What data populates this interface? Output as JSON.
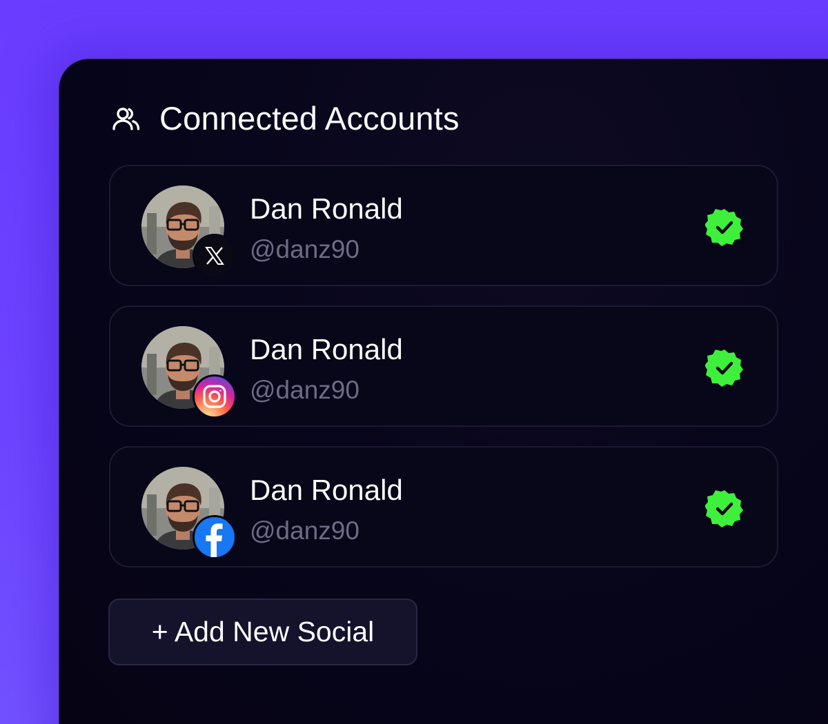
{
  "header": {
    "icon": "users-icon",
    "title": "Connected Accounts"
  },
  "accounts": [
    {
      "name": "Dan Ronald",
      "handle": "@danz90",
      "platform_icon": "x-logo-icon",
      "status_icon": "verified-check-icon"
    },
    {
      "name": "Dan Ronald",
      "handle": "@danz90",
      "platform_icon": "instagram-logo-icon",
      "status_icon": "verified-check-icon"
    },
    {
      "name": "Dan Ronald",
      "handle": "@danz90",
      "platform_icon": "facebook-logo-icon",
      "status_icon": "verified-check-icon"
    }
  ],
  "add_button": {
    "label": "+ Add New Social"
  },
  "colors": {
    "background": "#6a3cff",
    "panel": "#07051a",
    "verified": "#3ef03c",
    "handle_text": "#6f6b86",
    "facebook": "#1877f2"
  }
}
